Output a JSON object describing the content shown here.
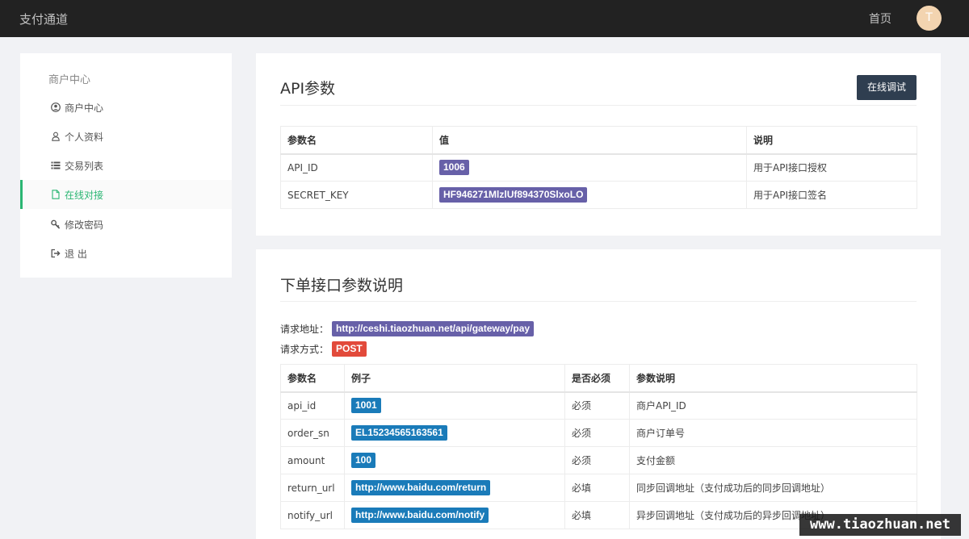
{
  "header": {
    "brand": "支付通道",
    "home": "首页",
    "avatar_initial": "T"
  },
  "sidebar": {
    "title": "商户中心",
    "items": [
      {
        "label": "商户中心",
        "icon": "user-circle-icon",
        "active": false
      },
      {
        "label": "个人资料",
        "icon": "user-icon",
        "active": false
      },
      {
        "label": "交易列表",
        "icon": "list-icon",
        "active": false
      },
      {
        "label": "在线对接",
        "icon": "file-icon",
        "active": true
      },
      {
        "label": "修改密码",
        "icon": "key-icon",
        "active": false
      },
      {
        "label": "退 出",
        "icon": "sign-out-icon",
        "active": false
      }
    ]
  },
  "api_params": {
    "title": "API参数",
    "debug_button": "在线调试",
    "headers": [
      "参数名",
      "值",
      "说明"
    ],
    "rows": [
      {
        "name": "API_ID",
        "value": "1006",
        "desc": "用于API接口授权"
      },
      {
        "name": "SECRET_KEY",
        "value": "HF946271MlzlUf894370SlxoLO",
        "desc": "用于API接口签名"
      }
    ]
  },
  "order_api": {
    "title": "下单接口参数说明",
    "request_url_label": "请求地址：",
    "request_url": "http://ceshi.tiaozhuan.net/api/gateway/pay",
    "request_method_label": "请求方式：",
    "request_method": "POST",
    "headers": [
      "参数名",
      "例子",
      "是否必须",
      "参数说明"
    ],
    "rows": [
      {
        "name": "api_id",
        "example": "1001",
        "required": "必须",
        "desc": "商户API_ID"
      },
      {
        "name": "order_sn",
        "example": "EL15234565163561",
        "required": "必须",
        "desc": "商户订单号"
      },
      {
        "name": "amount",
        "example": "100",
        "required": "必须",
        "desc": "支付金额"
      },
      {
        "name": "return_url",
        "example": "http://www.baidu.com/return",
        "required": "必填",
        "desc": "同步回调地址（支付成功后的同步回调地址）"
      },
      {
        "name": "notify_url",
        "example": "http://www.baidu.com/notify",
        "required": "必填",
        "desc": "异步回调地址（支付成功后的异步回调地址）"
      }
    ]
  },
  "watermark": "www.tiaozhuan.net",
  "colors": {
    "accent_green": "#2bb673",
    "tag_purple": "#6760a8",
    "tag_blue": "#1a7bb9",
    "tag_red": "#e24a3b",
    "button_dark": "#2f3e50"
  }
}
